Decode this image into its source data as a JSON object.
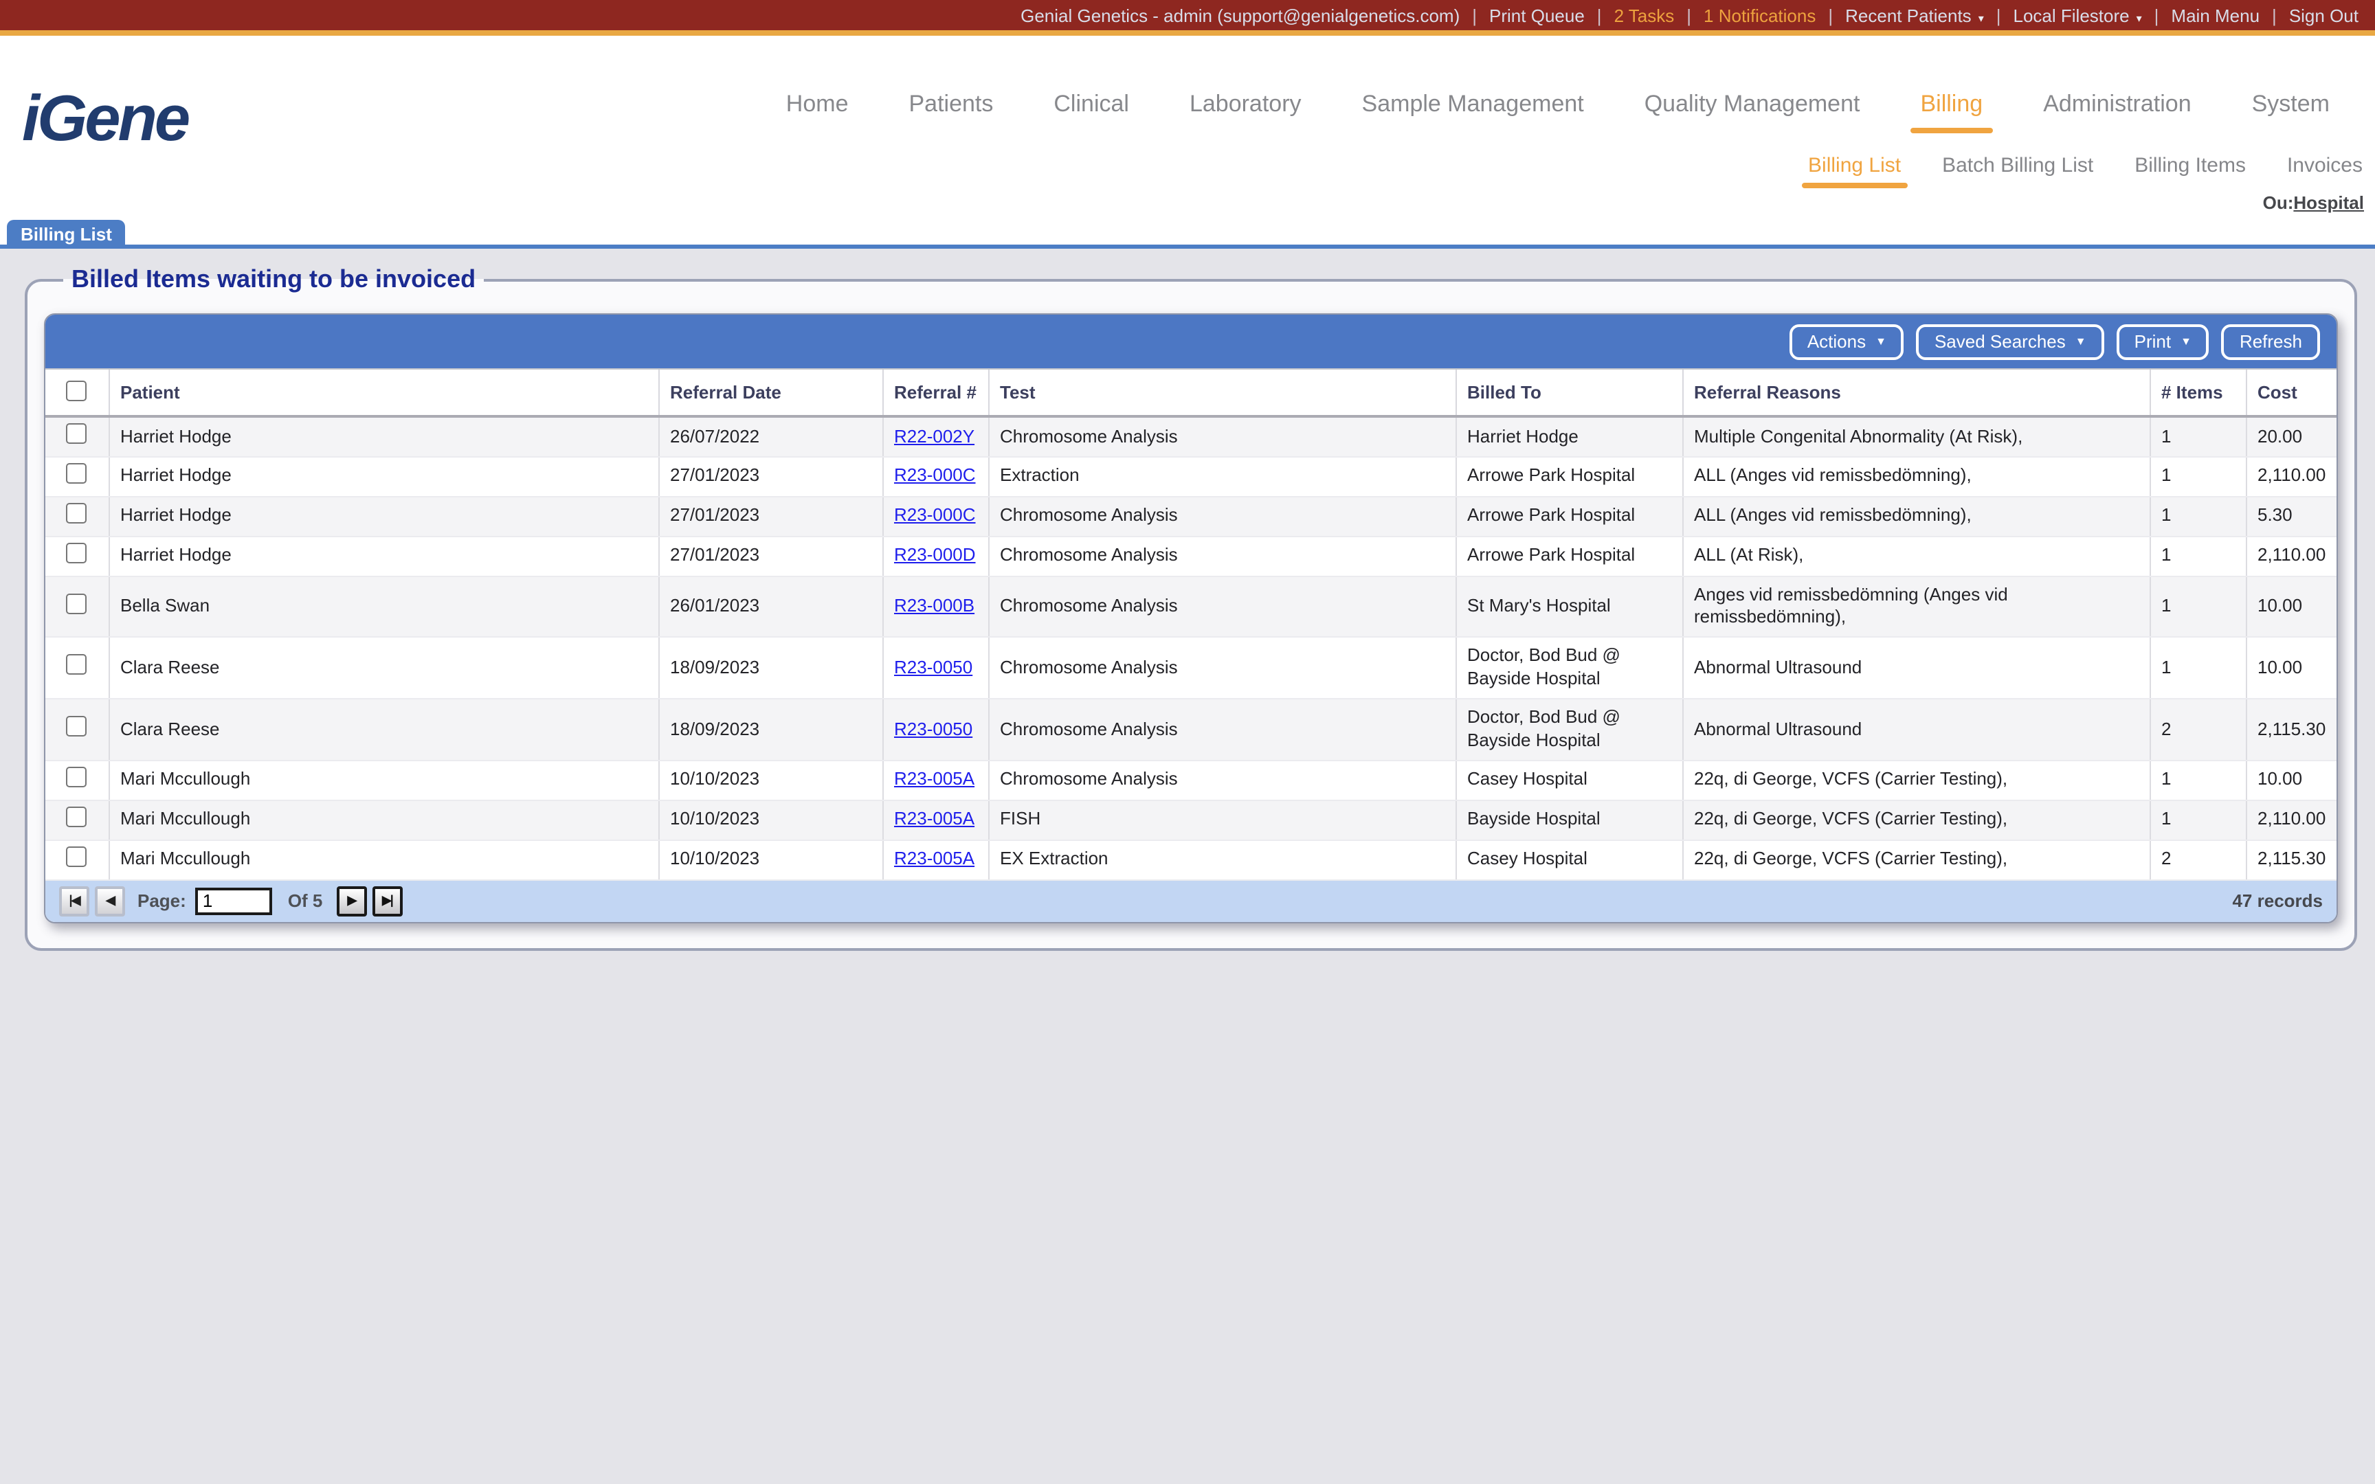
{
  "topbar": {
    "separator": "|",
    "caret": "▾",
    "items": [
      {
        "name": "account-info",
        "label": "Genial Genetics - admin (support@genialgenetics.com)",
        "style": "light",
        "caret": false,
        "clickable": false
      },
      {
        "name": "print-queue-link",
        "label": "Print Queue",
        "style": "light",
        "caret": false,
        "clickable": true
      },
      {
        "name": "tasks-link",
        "label": "2 Tasks",
        "style": "orange",
        "caret": false,
        "clickable": true
      },
      {
        "name": "notifications-link",
        "label": "1 Notifications",
        "style": "orange",
        "caret": false,
        "clickable": true
      },
      {
        "name": "recent-patients-menu",
        "label": "Recent Patients",
        "style": "light",
        "caret": true,
        "clickable": true
      },
      {
        "name": "local-filestore-menu",
        "label": "Local Filestore",
        "style": "light",
        "caret": true,
        "clickable": true
      },
      {
        "name": "main-menu-link",
        "label": "Main Menu",
        "style": "light",
        "caret": false,
        "clickable": true
      },
      {
        "name": "sign-out-link",
        "label": "Sign Out",
        "style": "light",
        "caret": false,
        "clickable": true
      }
    ]
  },
  "brand": {
    "logo": "iGene"
  },
  "main_nav": {
    "items": [
      {
        "name": "nav-home",
        "label": "Home",
        "active": false
      },
      {
        "name": "nav-patients",
        "label": "Patients",
        "active": false
      },
      {
        "name": "nav-clinical",
        "label": "Clinical",
        "active": false
      },
      {
        "name": "nav-laboratory",
        "label": "Laboratory",
        "active": false
      },
      {
        "name": "nav-sample-management",
        "label": "Sample Management",
        "active": false
      },
      {
        "name": "nav-quality-management",
        "label": "Quality Management",
        "active": false
      },
      {
        "name": "nav-billing",
        "label": "Billing",
        "active": true
      },
      {
        "name": "nav-administration",
        "label": "Administration",
        "active": false
      },
      {
        "name": "nav-system",
        "label": "System",
        "active": false
      }
    ]
  },
  "sub_nav": {
    "items": [
      {
        "name": "subnav-billing-list",
        "label": "Billing List",
        "active": true
      },
      {
        "name": "subnav-batch-billing-list",
        "label": "Batch Billing List",
        "active": false
      },
      {
        "name": "subnav-billing-items",
        "label": "Billing Items",
        "active": false
      },
      {
        "name": "subnav-invoices",
        "label": "Invoices",
        "active": false
      }
    ],
    "ou_label": "Ou:",
    "ou_value": "Hospital"
  },
  "tab": {
    "label": "Billing List"
  },
  "panel": {
    "legend": "Billed Items waiting to be invoiced",
    "toolbar": {
      "caret": "▼",
      "buttons": [
        {
          "name": "actions-button",
          "label": "Actions",
          "caret": true
        },
        {
          "name": "saved-searches-button",
          "label": "Saved Searches",
          "caret": true
        },
        {
          "name": "print-button",
          "label": "Print",
          "caret": true
        },
        {
          "name": "refresh-button",
          "label": "Refresh",
          "caret": false
        }
      ]
    },
    "table": {
      "columns": [
        "Patient",
        "Referral Date",
        "Referral #",
        "Test",
        "Billed To",
        "Referral Reasons",
        "# Items",
        "Cost"
      ],
      "rows": [
        {
          "patient": "Harriet Hodge",
          "referral_date": "26/07/2022",
          "referral_no": "R22-002Y",
          "test": "Chromosome Analysis",
          "billed_to": "Harriet Hodge",
          "reasons": "Multiple Congenital Abnormality (At Risk),",
          "items": "1",
          "cost": "20.00"
        },
        {
          "patient": "Harriet Hodge",
          "referral_date": "27/01/2023",
          "referral_no": "R23-000C",
          "test": "Extraction",
          "billed_to": "Arrowe Park Hospital",
          "reasons": "ALL (Anges vid remissbedömning),",
          "items": "1",
          "cost": "2,110.00"
        },
        {
          "patient": "Harriet Hodge",
          "referral_date": "27/01/2023",
          "referral_no": "R23-000C",
          "test": "Chromosome Analysis",
          "billed_to": "Arrowe Park Hospital",
          "reasons": "ALL (Anges vid remissbedömning),",
          "items": "1",
          "cost": "5.30"
        },
        {
          "patient": "Harriet Hodge",
          "referral_date": "27/01/2023",
          "referral_no": "R23-000D",
          "test": "Chromosome Analysis",
          "billed_to": "Arrowe Park Hospital",
          "reasons": "ALL (At Risk),",
          "items": "1",
          "cost": "2,110.00"
        },
        {
          "patient": "Bella Swan",
          "referral_date": "26/01/2023",
          "referral_no": "R23-000B",
          "test": "Chromosome Analysis",
          "billed_to": "St Mary's Hospital",
          "reasons": "Anges vid remissbedömning (Anges vid remissbedömning),",
          "items": "1",
          "cost": "10.00"
        },
        {
          "patient": "Clara Reese",
          "referral_date": "18/09/2023",
          "referral_no": "R23-0050",
          "test": "Chromosome Analysis",
          "billed_to": "Doctor, Bod Bud @ Bayside Hospital",
          "reasons": "Abnormal Ultrasound",
          "items": "1",
          "cost": "10.00"
        },
        {
          "patient": "Clara Reese",
          "referral_date": "18/09/2023",
          "referral_no": "R23-0050",
          "test": "Chromosome Analysis",
          "billed_to": "Doctor, Bod Bud @ Bayside Hospital",
          "reasons": "Abnormal Ultrasound",
          "items": "2",
          "cost": "2,115.30"
        },
        {
          "patient": "Mari Mccullough",
          "referral_date": "10/10/2023",
          "referral_no": "R23-005A",
          "test": "Chromosome Analysis",
          "billed_to": "Casey Hospital",
          "reasons": "22q, di George, VCFS (Carrier Testing),",
          "items": "1",
          "cost": "10.00"
        },
        {
          "patient": "Mari Mccullough",
          "referral_date": "10/10/2023",
          "referral_no": "R23-005A",
          "test": "FISH",
          "billed_to": "Bayside Hospital",
          "reasons": "22q, di George, VCFS (Carrier Testing),",
          "items": "1",
          "cost": "2,110.00"
        },
        {
          "patient": "Mari Mccullough",
          "referral_date": "10/10/2023",
          "referral_no": "R23-005A",
          "test": "EX Extraction",
          "billed_to": "Casey Hospital",
          "reasons": "22q, di George, VCFS (Carrier Testing),",
          "items": "2",
          "cost": "2,115.30"
        }
      ]
    },
    "pagination": {
      "page_label": "Page:",
      "page_value": "1",
      "of_label": "Of 5",
      "records": "47 records",
      "icons": {
        "first": "|◀",
        "prev": "◀",
        "next": "▶",
        "last": "▶|"
      }
    }
  },
  "colors": {
    "topbar_maroon": "#8E2720",
    "gold_accent": "#E9A843",
    "nav_active_orange": "#F0A440",
    "toolbar_blue": "#4C77C4",
    "tab_blue": "#4C7DC5",
    "pagination_blue": "#C2D6F3",
    "legend_navy": "#1B2B92",
    "link_blue": "#1E1EEC"
  }
}
